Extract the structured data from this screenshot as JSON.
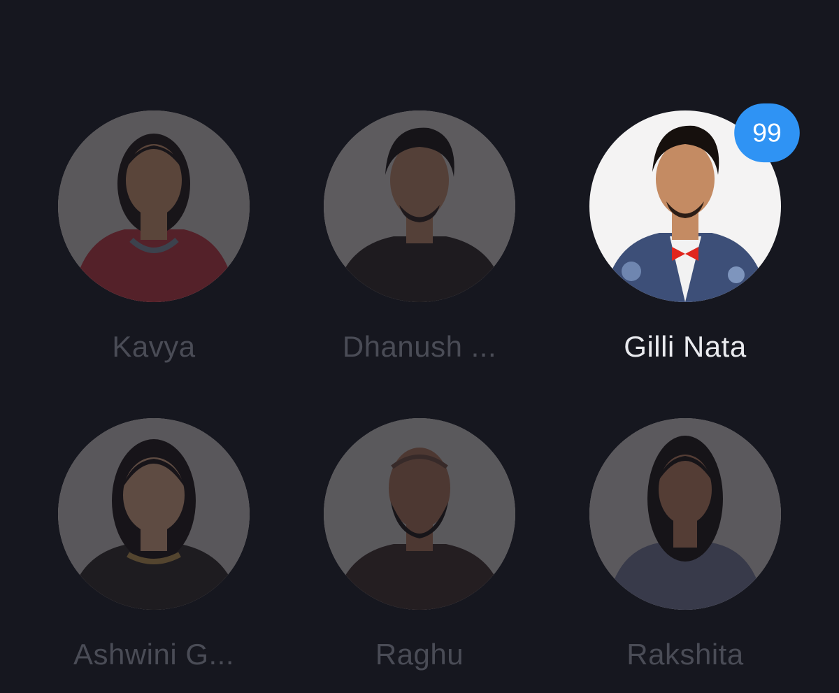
{
  "contestants": [
    {
      "name": "Kavya",
      "active": false,
      "bg": "#c9c2bd",
      "outfit": "#b8323c",
      "skin": "#c99068",
      "hair": "#1c1412"
    },
    {
      "name": "Dhanush ...",
      "active": false,
      "bg": "#cfcac6",
      "outfit": "#2a2320",
      "skin": "#b98362",
      "hair": "#17110e"
    },
    {
      "name": "Gilli Nata",
      "active": true,
      "badge": "99",
      "bg": "#f4f3f3",
      "outfit": "#3d4f78",
      "skin": "#c48b63",
      "hair": "#16100d"
    },
    {
      "name": "Ashwini G...",
      "active": false,
      "bg": "#c6c1bd",
      "outfit": "#2b2522",
      "skin": "#d2a07c",
      "hair": "#1a1210"
    },
    {
      "name": "Raghu",
      "active": false,
      "bg": "#c8c4c1",
      "outfit": "#3a2a26",
      "skin": "#a56f52",
      "hair": "#1a1412"
    },
    {
      "name": "Rakshita",
      "active": false,
      "bg": "#cbc6c2",
      "outfit": "#6e7390",
      "skin": "#b97c5a",
      "hair": "#17110f"
    }
  ],
  "colors": {
    "background": "#16171f",
    "inactive_text": "#4a4c56",
    "active_text": "#e9eaee",
    "badge": "#2f93f4"
  }
}
